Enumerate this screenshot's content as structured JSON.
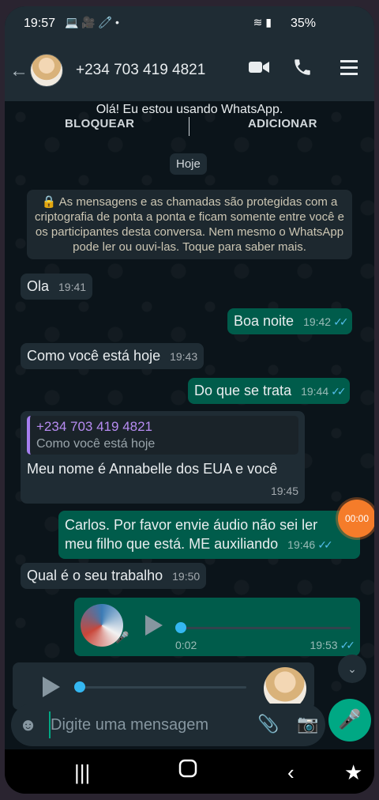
{
  "status_bar": {
    "time": "19:57",
    "battery": "35%"
  },
  "header": {
    "contact": "+234 703 419 4821"
  },
  "chat": {
    "status_message": "Olá! Eu estou usando WhatsApp.",
    "block_label": "BLOQUEAR",
    "add_label": "ADICIONAR",
    "date_label": "Hoje",
    "encryption_notice": "As mensagens e as chamadas são protegidas com a criptografia de ponta a ponta e ficam somente entre você e os participantes desta conversa. Nem mesmo o WhatsApp pode ler ou ouvi-las. Toque para saber mais.",
    "messages": [
      {
        "text": "Ola",
        "time": "19:41",
        "direction": "in"
      },
      {
        "text": "Boa noite",
        "time": "19:42",
        "direction": "out"
      },
      {
        "text": "Como você está hoje",
        "time": "19:43",
        "direction": "in"
      },
      {
        "text": "Do que se trata",
        "time": "19:44",
        "direction": "out"
      },
      {
        "quote_name": "+234 703 419 4821",
        "quote_text": "Como você está hoje",
        "text": "Meu nome é Annabelle dos EUA e você",
        "time": "19:45",
        "direction": "in"
      },
      {
        "text_line1": "Carlos. Por favor envie áudio não sei ler",
        "text_line2": "meu filho que está. ME auxiliando",
        "time": "19:46",
        "direction": "out"
      },
      {
        "text": "Qual é o seu trabalho",
        "time": "19:50",
        "direction": "in"
      },
      {
        "type": "audio",
        "duration": "0:02",
        "time": "19:53",
        "direction": "out"
      },
      {
        "type": "audio",
        "direction": "in"
      }
    ]
  },
  "recording_timer": "00:00",
  "input": {
    "placeholder": "Digite uma mensagem"
  },
  "colors": {
    "outgoing": "#005c4b",
    "incoming": "#1f2c34",
    "accent": "#00a884",
    "read_ticks": "#53bdeb"
  }
}
